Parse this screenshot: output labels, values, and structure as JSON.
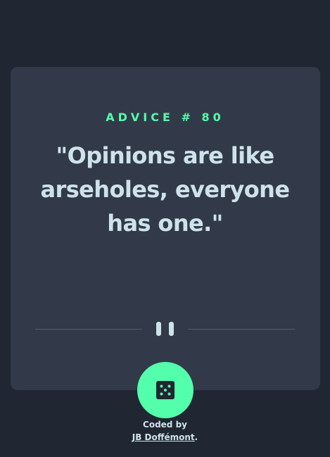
{
  "advice": {
    "heading": "ADVICE # 80",
    "quote": "\"Opinions are like arseholes, everyone has one.\""
  },
  "actions": {
    "dice_icon": "dice-icon",
    "divider_icon": "pause-icon"
  },
  "footer": {
    "coded_by": "Coded by",
    "author": "JB Doffémont",
    "period": "."
  },
  "colors": {
    "background": "#202632",
    "card": "#323a49",
    "accent": "#53ffaa",
    "text": "#cee3e9",
    "divider": "#4f5d74"
  }
}
